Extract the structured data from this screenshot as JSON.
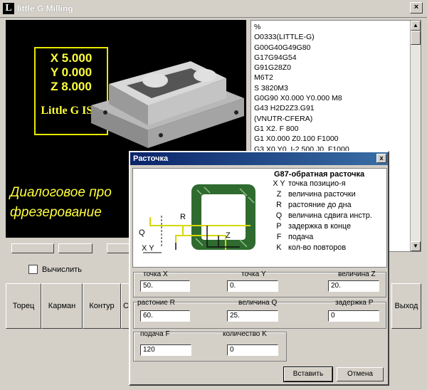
{
  "app": {
    "title": "little G Milling",
    "logo": "L"
  },
  "viewport": {
    "x": "X 5.000",
    "y": "Y 0.000",
    "z": "Z 8.000",
    "brand": "Little G ISO",
    "text_line1": "Диалоговое про",
    "text_line2": "фрезерование"
  },
  "gcode_lines": [
    "%",
    "O0333(LITTLE-G)",
    "G00G40G49G80",
    "G17G94G54",
    "G91G28Z0",
    "M6T2",
    "S 3820M3",
    "G0G90 X0.000 Y0.000  M8",
    "G43 H2D2Z3.G91",
    "(VNUTR-CFERA)",
    " G1 X2. F 800",
    " G1 X0.000 Z0.100 F1000",
    " G3 X0.Y0. I-2.500 J0. F1000"
  ],
  "main": {
    "calc_label": "Вычислить",
    "buttons": [
      "Торец",
      "Карман",
      "Контур",
      "С",
      "Выход"
    ]
  },
  "dialog": {
    "title": "Расточка",
    "close": "x",
    "header": "G87-обратная расточка",
    "legend": [
      {
        "key": "X Y",
        "text": "точка позицио-я"
      },
      {
        "key": "Z",
        "text": "величина расточки"
      },
      {
        "key": "R",
        "text": "растояние до дна"
      },
      {
        "key": "Q",
        "text": "величина сдвига инстр."
      },
      {
        "key": "P",
        "text": "задержка в конце"
      },
      {
        "key": "F",
        "text": "подача"
      },
      {
        "key": "K",
        "text": "кол-во повторов"
      }
    ],
    "diagram_labels": {
      "r": "R",
      "q": "Q",
      "xy": "X  Y",
      "z": "Z"
    },
    "fields": {
      "x_label": "точка  X",
      "x_value": "50.",
      "y_label": "точка  Y",
      "y_value": "0.",
      "z_label": "величина  Z",
      "z_value": "20.",
      "r_label": "растоние  R",
      "r_value": "60.",
      "q_label": "величина  Q",
      "q_value": "25.",
      "p_label": "задержка  P",
      "p_value": "0",
      "f_label": "подача  F",
      "f_value": "120",
      "k_label": "количество  K",
      "k_value": "0"
    },
    "insert_label": "Вставить",
    "cancel_label": "Отмена"
  },
  "colors": {
    "accent_yellow": "#ffff3c",
    "part_green": "#2f6b2f",
    "titlebar_blue": "#0a246a"
  }
}
